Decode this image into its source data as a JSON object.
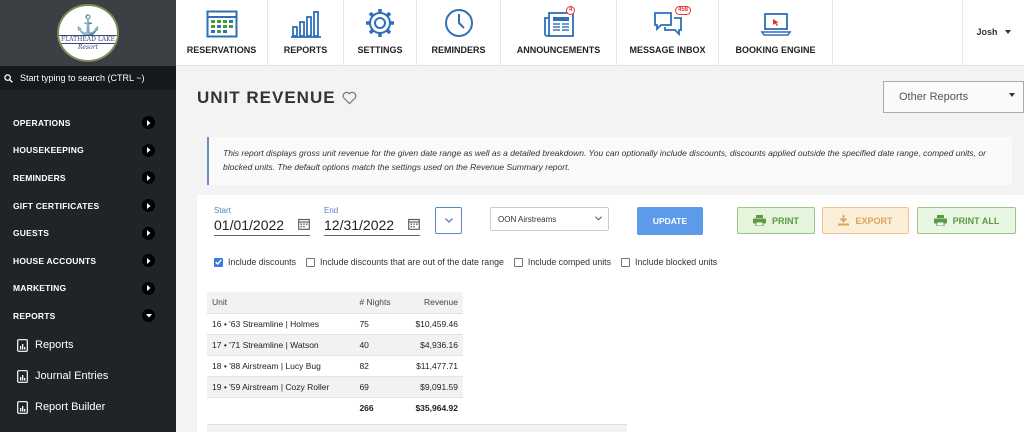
{
  "brand": {
    "logo_line1": "FLATHEAD LAKE",
    "logo_line2": "Resort"
  },
  "search": {
    "placeholder": "Start typing to search (CTRL ~)"
  },
  "sidebar": {
    "items": [
      {
        "label": "OPERATIONS"
      },
      {
        "label": "HOUSEKEEPING"
      },
      {
        "label": "REMINDERS"
      },
      {
        "label": "GIFT CERTIFICATES"
      },
      {
        "label": "GUESTS"
      },
      {
        "label": "HOUSE ACCOUNTS"
      },
      {
        "label": "MARKETING"
      },
      {
        "label": "REPORTS",
        "expanded": true
      }
    ],
    "subitems": [
      {
        "label": "Reports"
      },
      {
        "label": "Journal Entries"
      },
      {
        "label": "Report Builder"
      }
    ]
  },
  "topnav": {
    "items": [
      {
        "label": "RESERVATIONS",
        "icon": "calendar-grid-icon"
      },
      {
        "label": "REPORTS",
        "icon": "bar-chart-icon"
      },
      {
        "label": "SETTINGS",
        "icon": "gear-icon"
      },
      {
        "label": "REMINDERS",
        "icon": "clock-icon"
      },
      {
        "label": "ANNOUNCEMENTS",
        "icon": "newspaper-icon",
        "badge": "4"
      },
      {
        "label": "MESSAGE INBOX",
        "icon": "chat-icon",
        "badge": "458"
      },
      {
        "label": "BOOKING ENGINE",
        "icon": "laptop-icon"
      }
    ],
    "user": "Josh"
  },
  "page": {
    "title": "UNIT REVENUE",
    "other_reports": "Other Reports",
    "info": "This report displays gross unit revenue for the given date range as well as a detailed breakdown. You can optionally include discounts, discounts applied outside the specified date range, comped units, or blocked units. The default options match the settings used on the Revenue Summary report."
  },
  "filters": {
    "start_label": "Start",
    "start_value": "01/01/2022",
    "end_label": "End",
    "end_value": "12/31/2022",
    "group": "OON Airstreams",
    "update": "UPDATE",
    "print": "PRINT",
    "export": "EXPORT",
    "print_all": "PRINT ALL"
  },
  "checks": [
    {
      "label": "Include discounts",
      "checked": true
    },
    {
      "label": "Include discounts that are out of the date range",
      "checked": false
    },
    {
      "label": "Include comped units",
      "checked": false
    },
    {
      "label": "Include blocked units",
      "checked": false
    }
  ],
  "table": {
    "headers": [
      "Unit",
      "# Nights",
      "Revenue"
    ],
    "rows": [
      [
        "16 • '63 Streamline | Holmes",
        "75",
        "$10,459.46"
      ],
      [
        "17 • '71 Streamline | Watson",
        "40",
        "$4,936.16"
      ],
      [
        "18 • '88 Airstream | Lucy Bug",
        "82",
        "$11,477.71"
      ],
      [
        "19 • '59 Airstream | Cozy Roller",
        "69",
        "$9,091.59"
      ]
    ],
    "total": [
      "",
      "266",
      "$35,964.92"
    ]
  },
  "colors": {
    "sidebar": "#202428",
    "accent": "#5b9bea",
    "print_green": "#5a9a43",
    "export_orange": "#dba457"
  }
}
